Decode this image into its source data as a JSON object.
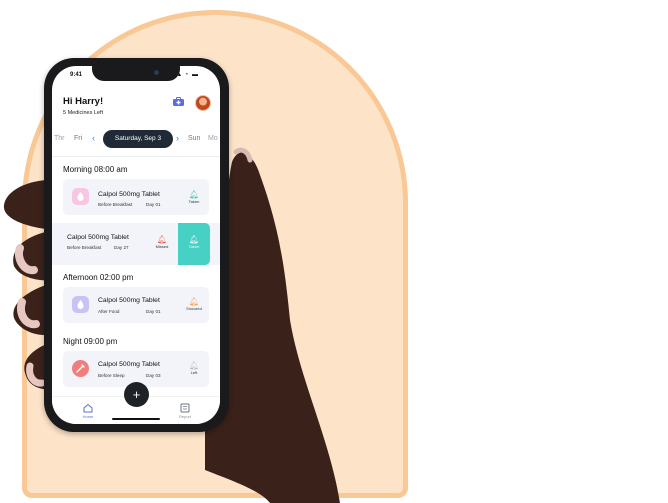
{
  "status": {
    "time": "9:41",
    "icons": "▴ ◔ ▬"
  },
  "header": {
    "greeting": "Hi Harry!",
    "subtitle": "5 Medicines Left"
  },
  "dates": {
    "prev_far": "Thr",
    "prev": "Fri",
    "selected": "Saturday, Sep 3",
    "next": "Sun",
    "next_far": "Mo"
  },
  "sections": {
    "morning": "Morning 08:00 am",
    "afternoon": "Afternoon 02:00 pm",
    "night": "Night 09:00 pm"
  },
  "cards": [
    {
      "name": "Calpol 500mg Tablet",
      "timing": "Before Breakfast",
      "day": "Day 01",
      "status": "Taken",
      "color": "#f7c6e4"
    },
    {
      "name": "Calpol 500mg Tablet",
      "timing": "Before Breakfast",
      "day": "Day 27",
      "status": "Missed",
      "swipe_action": "Taken"
    },
    {
      "name": "Calpol 500mg Tablet",
      "timing": "After Food",
      "day": "Day 01",
      "status": "Snoozed",
      "color": "#c7c3f3"
    },
    {
      "name": "Calpol 500mg Tablet",
      "timing": "Before Sleep",
      "day": "Day 03",
      "status": "Left",
      "color": "#f37d7d"
    }
  ],
  "fab": "+",
  "nav": {
    "home": "Home",
    "report": "Report"
  },
  "colors": {
    "arch_fill": "#fde4c8",
    "arch_border": "#f9c895",
    "teal": "#46d1c4",
    "pill_dark": "#1f2a36"
  }
}
